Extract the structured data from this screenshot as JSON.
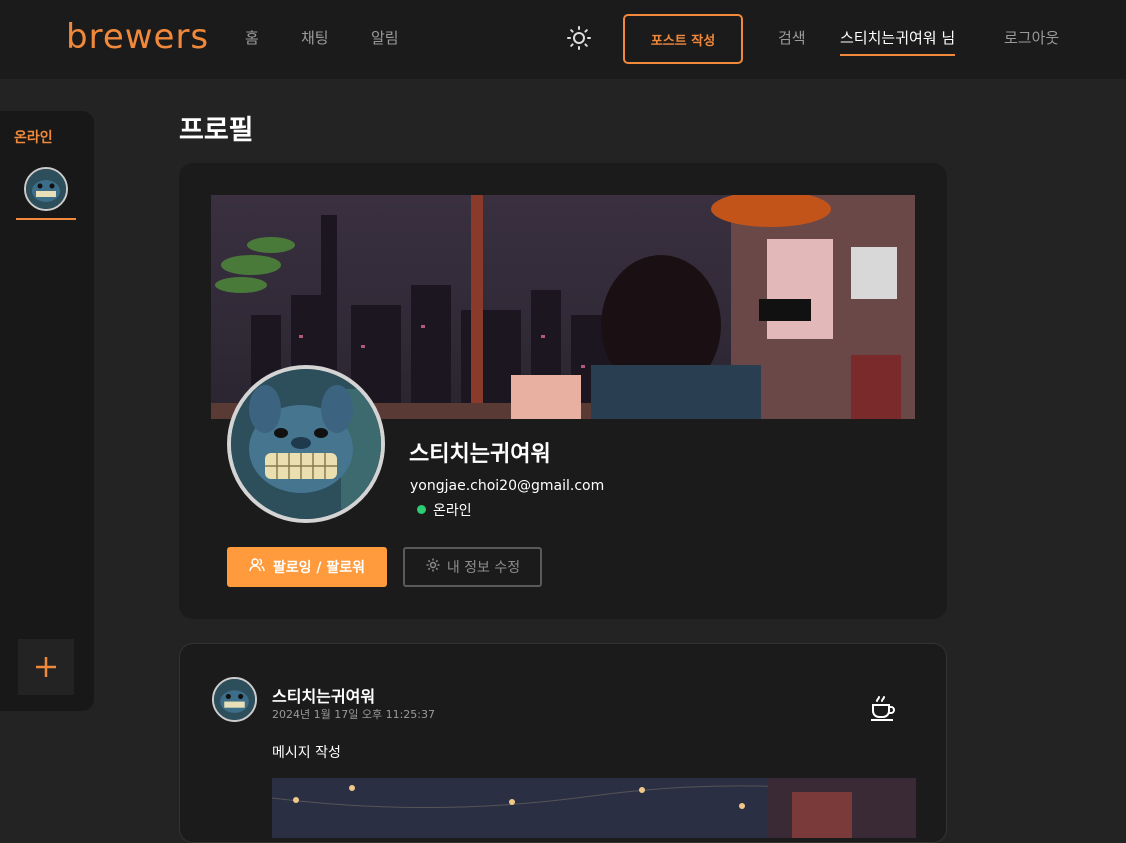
{
  "header": {
    "logo": "brewers",
    "nav": [
      "홈",
      "채팅",
      "알림"
    ],
    "theme_icon": "sun-icon",
    "post_button": "포스트 작성",
    "search": "검색",
    "user": "스티치는귀여워 님",
    "logout": "로그아웃",
    "accent_color": "#f0893b"
  },
  "online_panel": {
    "title": "온라인",
    "add_icon": "plus-icon"
  },
  "page_title": "프로필",
  "profile": {
    "name": "스티치는귀여워",
    "email": "yongjae.choi20@gmail.com",
    "status": "온라인",
    "status_color": "#2ecc71",
    "follow_button": "팔로잉 / 팔로워",
    "edit_button": "내 정보 수정"
  },
  "post": {
    "author": "스티치는귀여워",
    "timestamp": "2024년 1월 17일 오후 11:25:37",
    "text": "메시지 작성",
    "action_icon": "coffee-cup-icon"
  }
}
